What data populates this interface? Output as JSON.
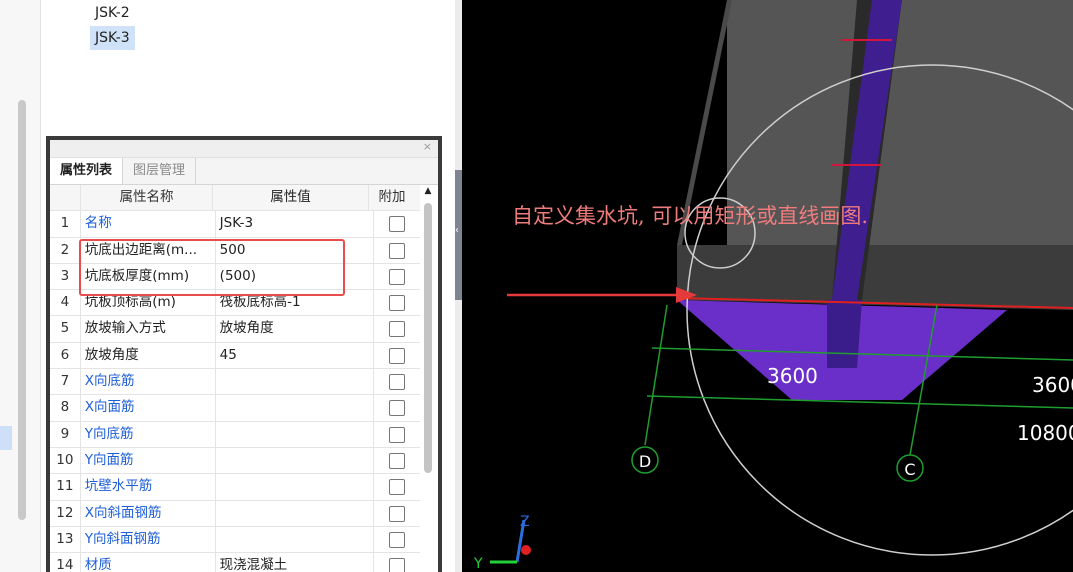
{
  "tree": {
    "items": [
      "JSK-2",
      "JSK-3"
    ],
    "selected_index": 1
  },
  "panel": {
    "close_label": "×",
    "tabs": [
      "属性列表",
      "图层管理"
    ],
    "active_tab": 0,
    "columns": [
      "属性名称",
      "属性值",
      "附加"
    ],
    "rows": [
      {
        "num": "1",
        "name": "名称",
        "value": "JSK-3",
        "blue": true
      },
      {
        "num": "2",
        "name": "坑底出边距离(m...",
        "value": "500",
        "blue": false
      },
      {
        "num": "3",
        "name": "坑底板厚度(mm)",
        "value": "(500)",
        "blue": false
      },
      {
        "num": "4",
        "name": "坑板顶标高(m)",
        "value": "筏板底标高-1",
        "blue": false
      },
      {
        "num": "5",
        "name": "放坡输入方式",
        "value": "放坡角度",
        "blue": false
      },
      {
        "num": "6",
        "name": "放坡角度",
        "value": "45",
        "blue": false
      },
      {
        "num": "7",
        "name": "X向底筋",
        "value": "",
        "blue": true
      },
      {
        "num": "8",
        "name": "X向面筋",
        "value": "",
        "blue": true
      },
      {
        "num": "9",
        "name": "Y向底筋",
        "value": "",
        "blue": true
      },
      {
        "num": "10",
        "name": "Y向面筋",
        "value": "",
        "blue": true
      },
      {
        "num": "11",
        "name": "坑壁水平筋",
        "value": "",
        "blue": true
      },
      {
        "num": "12",
        "name": "X向斜面钢筋",
        "value": "",
        "blue": true
      },
      {
        "num": "13",
        "name": "Y向斜面钢筋",
        "value": "",
        "blue": true
      },
      {
        "num": "14",
        "name": "材质",
        "value": "现浇混凝土",
        "blue": true
      }
    ]
  },
  "viewport": {
    "annotation": "自定义集水坑, 可以用矩形或直线画图.",
    "dim_left": "3600",
    "dim_right": "3600",
    "dim_total": "10800",
    "axis_d": "D",
    "axis_c": "C",
    "triad_y": "Y",
    "triad_z": "Z"
  },
  "colors": {
    "pit": "#6a2fc8",
    "grid": "#1f9e2f",
    "annotation": "#ef7c7c",
    "highlight": "#e84c4c"
  }
}
